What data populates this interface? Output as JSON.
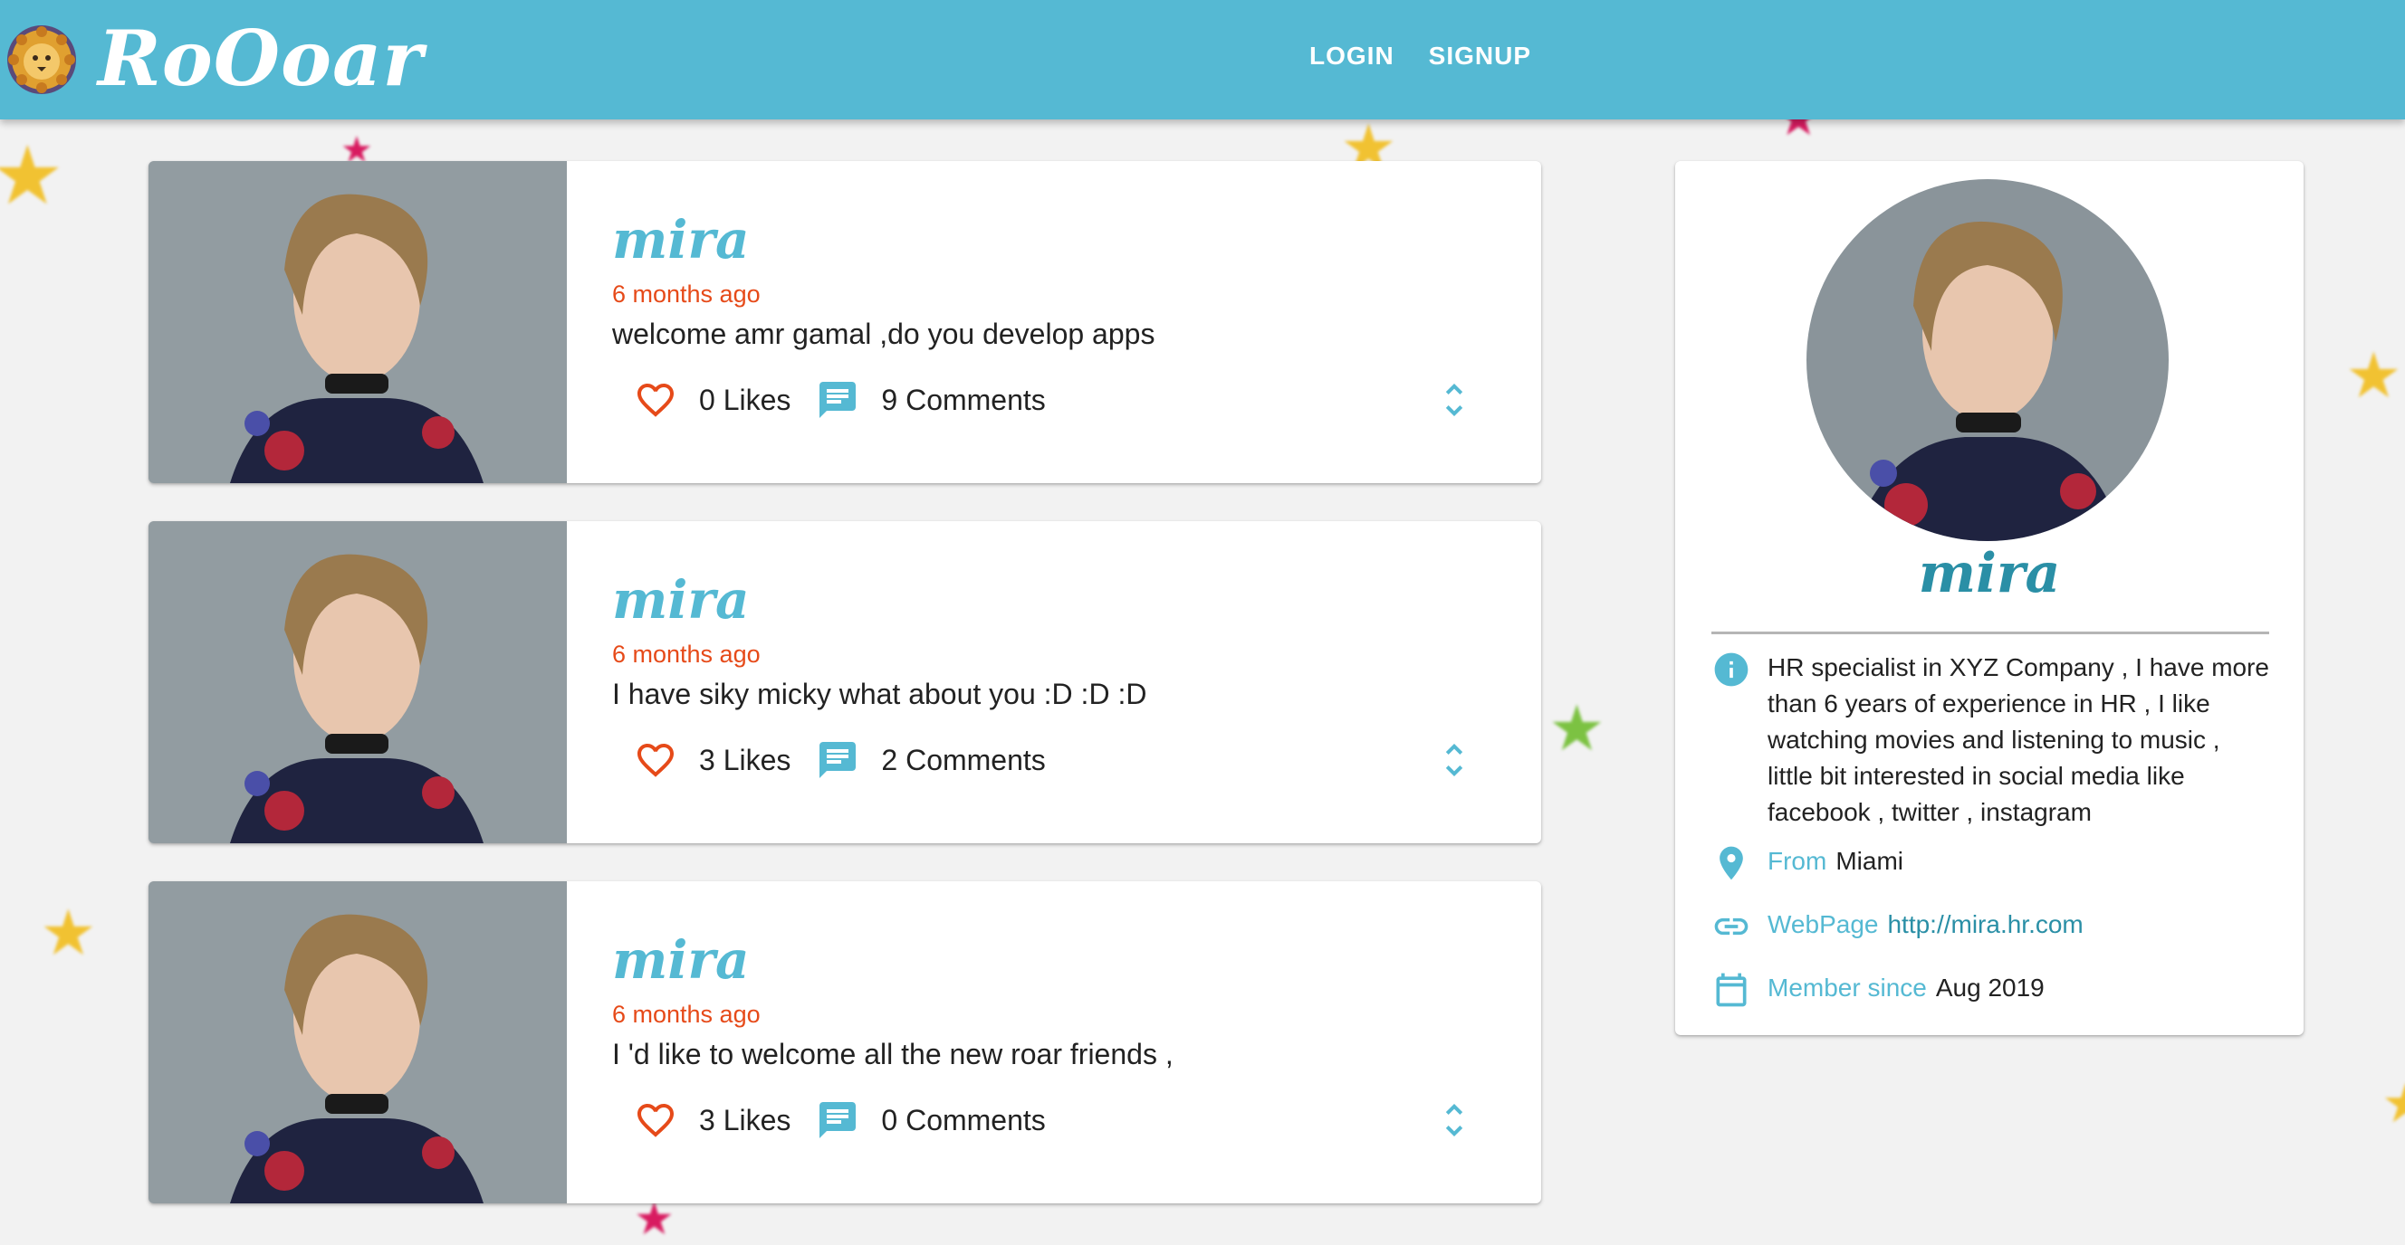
{
  "app": {
    "title": "RoOoar",
    "nav": {
      "login_label": "LOGIN",
      "signup_label": "SIGNUP"
    },
    "accent_color": "#55b9d3",
    "time_color": "#e64a19"
  },
  "posts": [
    {
      "user": "mira",
      "time": "6 months ago",
      "text": "welcome amr gamal ,do you develop apps",
      "likes_label": "0 Likes",
      "comments_label": "9 Comments"
    },
    {
      "user": "mira",
      "time": "6 months ago",
      "text": "I have siky micky what about you :D :D :D",
      "likes_label": "3 Likes",
      "comments_label": "2 Comments"
    },
    {
      "user": "mira",
      "time": "6 months ago",
      "text": "I 'd like to welcome all the new roar friends ,",
      "likes_label": "3 Likes",
      "comments_label": "0 Comments"
    }
  ],
  "profile": {
    "name": "mira",
    "bio_lines": [
      "HR specialist in XYZ Company , I have more",
      "than 6 years of experience in HR , I like",
      "watching movies and listening to music ,",
      "little bit interested in social media like",
      "facebook , twitter , instagram"
    ],
    "from_label": "From",
    "from_value": "Miami",
    "webpage_label": "WebPage",
    "webpage_value": "http://mira.hr.com",
    "member_label": "Member since",
    "member_value": "Aug 2019"
  },
  "icons": {
    "logo": "lion-icon",
    "like": "heart-outline-icon",
    "comment": "chat-icon",
    "expand": "unfold-more-icon",
    "info": "info-icon",
    "location": "location-pin-icon",
    "link": "link-icon",
    "calendar": "calendar-icon"
  }
}
